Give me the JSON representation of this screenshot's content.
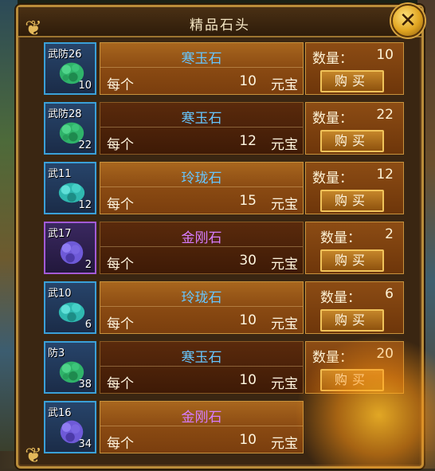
{
  "dialog": {
    "title": "精品石头",
    "close_icon": "close-x-icon"
  },
  "labels": {
    "per": "每个",
    "unit": "元宝",
    "qty_prefix": "数量：",
    "buy": "购买"
  },
  "colors": {
    "name_blue": "#66c6ff",
    "name_purple": "#d77cff",
    "gem_green": "#2fb36a",
    "gem_teal": "#2fb8b0",
    "gem_purple": "#6e5ad8"
  },
  "items": [
    {
      "icon_label": "武防26",
      "count": "10",
      "name": "寒玉石",
      "name_color": "blue",
      "price": "10",
      "qty": "10",
      "gem": "green"
    },
    {
      "icon_label": "武防28",
      "count": "22",
      "name": "寒玉石",
      "name_color": "blue",
      "price": "12",
      "qty": "22",
      "gem": "green"
    },
    {
      "icon_label": "武11",
      "count": "12",
      "name": "玲珑石",
      "name_color": "blue",
      "price": "15",
      "qty": "12",
      "gem": "teal"
    },
    {
      "icon_label": "武17",
      "count": "2",
      "name": "金刚石",
      "name_color": "purple",
      "price": "30",
      "qty": "2",
      "gem": "purple"
    },
    {
      "icon_label": "武10",
      "count": "6",
      "name": "玲珑石",
      "name_color": "blue",
      "price": "10",
      "qty": "6",
      "gem": "teal"
    },
    {
      "icon_label": "防3",
      "count": "38",
      "name": "寒玉石",
      "name_color": "blue",
      "price": "10",
      "qty": "20",
      "gem": "green"
    },
    {
      "icon_label": "武16",
      "count": "34",
      "name": "金刚石",
      "name_color": "purple",
      "price": "10",
      "qty": "",
      "gem": "purple"
    }
  ]
}
